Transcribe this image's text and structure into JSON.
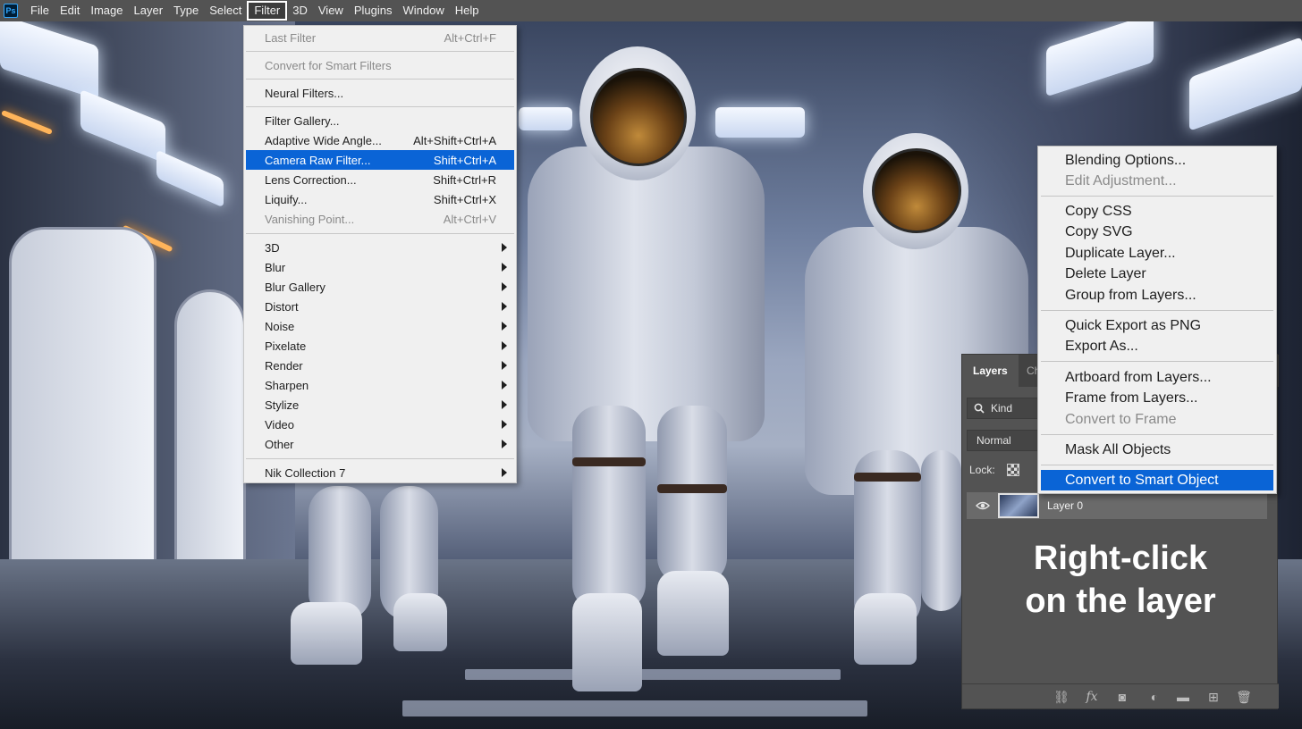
{
  "app": {
    "logo": "Ps"
  },
  "menubar": {
    "items": [
      "File",
      "Edit",
      "Image",
      "Layer",
      "Type",
      "Select",
      "Filter",
      "3D",
      "View",
      "Plugins",
      "Window",
      "Help"
    ],
    "active": "Filter"
  },
  "filter_menu": {
    "last_filter": {
      "label": "Last Filter",
      "shortcut": "Alt+Ctrl+F",
      "disabled": true
    },
    "convert_smart": {
      "label": "Convert for Smart Filters",
      "disabled": true
    },
    "neural": {
      "label": "Neural Filters..."
    },
    "filter_gallery": {
      "label": "Filter Gallery..."
    },
    "adaptive": {
      "label": "Adaptive Wide Angle...",
      "shortcut": "Alt+Shift+Ctrl+A"
    },
    "camera_raw": {
      "label": "Camera Raw Filter...",
      "shortcut": "Shift+Ctrl+A",
      "highlighted": true
    },
    "lens": {
      "label": "Lens Correction...",
      "shortcut": "Shift+Ctrl+R"
    },
    "liquify": {
      "label": "Liquify...",
      "shortcut": "Shift+Ctrl+X"
    },
    "vanishing": {
      "label": "Vanishing Point...",
      "shortcut": "Alt+Ctrl+V",
      "disabled": true
    },
    "submenus": [
      "3D",
      "Blur",
      "Blur Gallery",
      "Distort",
      "Noise",
      "Pixelate",
      "Render",
      "Sharpen",
      "Stylize",
      "Video",
      "Other"
    ],
    "nik": {
      "label": "Nik Collection 7"
    }
  },
  "layers_panel": {
    "tabs": [
      "Layers",
      "Ch"
    ],
    "kind_label": "Kind",
    "blend_mode": "Normal",
    "lock_label": "Lock:",
    "layer_name": "Layer 0"
  },
  "caption": {
    "line1": "Right-click",
    "line2": "on the layer"
  },
  "context_menu": {
    "blending": "Blending Options...",
    "edit_adjustment": "Edit Adjustment...",
    "copy_css": "Copy CSS",
    "copy_svg": "Copy SVG",
    "duplicate": "Duplicate Layer...",
    "delete": "Delete Layer",
    "group": "Group from Layers...",
    "quick_export": "Quick Export as PNG",
    "export_as": "Export As...",
    "artboard": "Artboard from Layers...",
    "frame": "Frame from Layers...",
    "convert_frame": "Convert to Frame",
    "mask_all": "Mask All Objects",
    "convert_smart": "Convert to Smart Object"
  },
  "colors": {
    "highlight": "#0a64d6",
    "menu_bg": "#f0f0f0",
    "panel_bg": "#535353"
  }
}
